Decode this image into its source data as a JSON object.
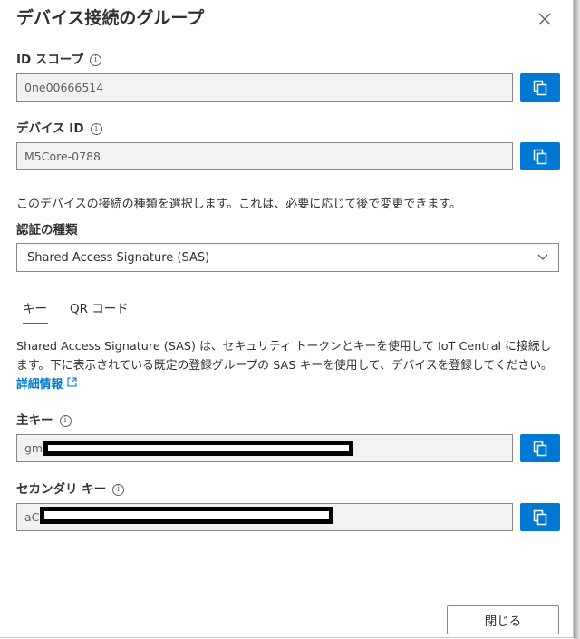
{
  "dialog": {
    "title": "デバイス接続のグループ",
    "close_icon": "close-icon"
  },
  "id_scope": {
    "label": "ID スコープ",
    "value": "0ne00666514"
  },
  "device_id": {
    "label": "デバイス ID",
    "value": "M5Core-0788"
  },
  "connection_description": "このデバイスの接続の種類を選択します。これは、必要に応じて後で変更できます。",
  "auth_type": {
    "label": "認証の種類",
    "selected": "Shared Access Signature (SAS)"
  },
  "tabs": [
    {
      "label": "キー",
      "active": true
    },
    {
      "label": "QR コード",
      "active": false
    }
  ],
  "sas_description": {
    "text": "Shared Access Signature (SAS) は、セキュリティ トークンとキーを使用して IoT Central に接続します。下に表示されている既定の登録グループの SAS キーを使用して、デバイスを登録してください。",
    "link_text": "詳細情報"
  },
  "primary_key": {
    "label": "主キー",
    "value_prefix": "gm"
  },
  "secondary_key": {
    "label": "セカンダリ キー",
    "value_prefix": "aC"
  },
  "footer": {
    "close_label": "閉じる"
  },
  "icons": {
    "info": "i",
    "copy": "copy-icon",
    "chevron": "chevron-down-icon",
    "external_link": "external-link-icon"
  },
  "colors": {
    "accent": "#0078d4",
    "field_background": "#f3f2f1",
    "border": "#8a8886"
  }
}
